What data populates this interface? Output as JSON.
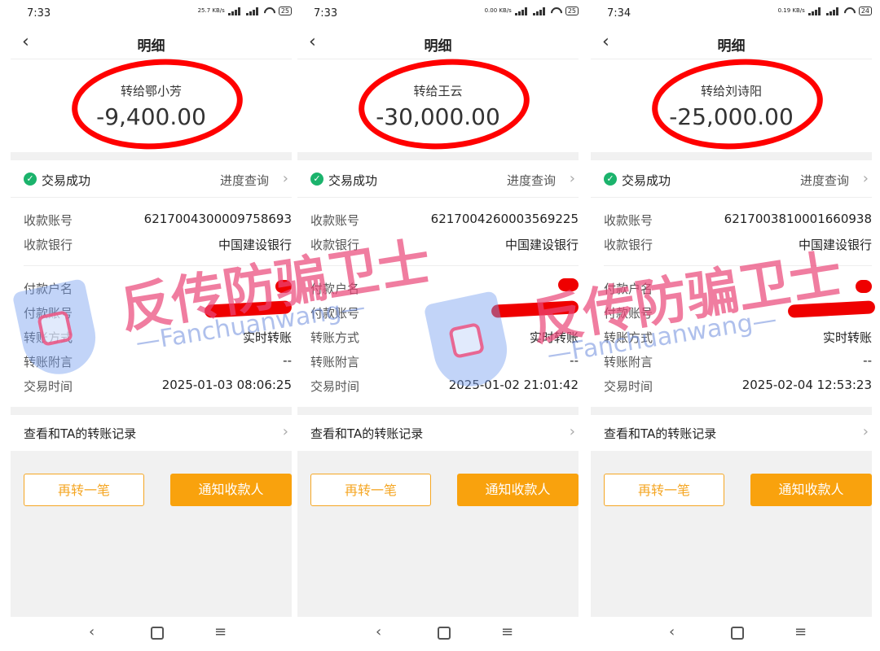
{
  "screens": [
    {
      "time": "7:33",
      "net_rate": "25.7 KB/s",
      "battery": "25",
      "title": "明细",
      "payee": "转给鄂小芳",
      "amount": "-9,400.00",
      "status": "交易成功",
      "progress": "进度查询",
      "fields": [
        {
          "k": "收款账号",
          "v": "6217004300009758693"
        },
        {
          "k": "收款银行",
          "v": "中国建设银行"
        },
        {
          "k": "付款户名",
          "v": ""
        },
        {
          "k": "付款账号",
          "v": ""
        },
        {
          "k": "转账方式",
          "v": "实时转账"
        },
        {
          "k": "转账附言",
          "v": "--"
        },
        {
          "k": "交易时间",
          "v": "2025-01-03 08:06:25"
        }
      ],
      "records": "查看和TA的转账记录",
      "btn_again": "再转一笔",
      "btn_notify": "通知收款人"
    },
    {
      "time": "7:33",
      "net_rate": "0.00 KB/s",
      "battery": "25",
      "title": "明细",
      "payee": "转给王云",
      "amount": "-30,000.00",
      "status": "交易成功",
      "progress": "进度查询",
      "fields": [
        {
          "k": "收款账号",
          "v": "6217004260003569225"
        },
        {
          "k": "收款银行",
          "v": "中国建设银行"
        },
        {
          "k": "付款户名",
          "v": ""
        },
        {
          "k": "付款账号",
          "v": ""
        },
        {
          "k": "转账方式",
          "v": "实时转账"
        },
        {
          "k": "转账附言",
          "v": "--"
        },
        {
          "k": "交易时间",
          "v": "2025-01-02 21:01:42"
        }
      ],
      "records": "查看和TA的转账记录",
      "btn_again": "再转一笔",
      "btn_notify": "通知收款人"
    },
    {
      "time": "7:34",
      "net_rate": "0.19 KB/s",
      "battery": "24",
      "title": "明细",
      "payee": "转给刘诗阳",
      "amount": "-25,000.00",
      "status": "交易成功",
      "progress": "进度查询",
      "fields": [
        {
          "k": "收款账号",
          "v": "6217003810001660938"
        },
        {
          "k": "收款银行",
          "v": "中国建设银行"
        },
        {
          "k": "付款户名",
          "v": ""
        },
        {
          "k": "付款账号",
          "v": ""
        },
        {
          "k": "转账方式",
          "v": "实时转账"
        },
        {
          "k": "转账附言",
          "v": "--"
        },
        {
          "k": "交易时间",
          "v": "2025-02-04 12:53:23"
        }
      ],
      "records": "查看和TA的转账记录",
      "btn_again": "再转一笔",
      "btn_notify": "通知收款人"
    }
  ],
  "watermark": {
    "title": "反传防骗卫士",
    "subtitle": "—Fanchuanwang—"
  },
  "icons": {
    "back": "chevron-left-icon",
    "check": "check-circle-icon",
    "chevron": "chevron-right-icon"
  },
  "colors": {
    "accent": "#f9a20d",
    "success": "#1bb36c",
    "annotation": "#ff0000"
  }
}
